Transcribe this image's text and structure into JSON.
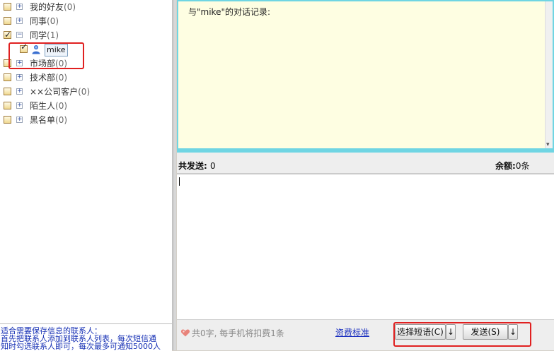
{
  "tree": {
    "groups": [
      {
        "name": "我的好友",
        "count": "(0)",
        "checked": false
      },
      {
        "name": "同事",
        "count": "(0)",
        "checked": false
      },
      {
        "name": "同学",
        "count": "(1)",
        "checked": true
      }
    ],
    "child": {
      "name": "mike"
    },
    "groups_after": [
      {
        "name": "市场部",
        "count": "(0)"
      },
      {
        "name": "技术部",
        "count": "(0)"
      },
      {
        "name": "××公司客户",
        "count": "(0)"
      },
      {
        "name": "陌生人",
        "count": "(0)"
      },
      {
        "name": "黑名单",
        "count": "(0)"
      }
    ]
  },
  "tip": {
    "line1": "适合需要保存信息的联系人：",
    "line2": "首先把联系人添加到联系人列表，每次短信通",
    "line3": "知时勾选联系人即可，每次最多可通知5000人"
  },
  "history": {
    "title": "与\"mike\"的对话记录:"
  },
  "info": {
    "sent_label": "共发送:",
    "sent_value": "0",
    "balance_label": "余额:",
    "balance_value": "0条"
  },
  "bottom": {
    "count_text": "共0字, 每手机将扣费1条",
    "fee_link": "资费标准",
    "phrase_button": "选择短语(C)",
    "phrase_arrow": "↓",
    "send_button": "发送(S)",
    "send_arrow": "↓"
  },
  "colors": {
    "accent_cyan": "#6fd5e3",
    "highlight_red": "#e02020",
    "history_bg": "#fefee2",
    "tip_text": "#1630b5"
  }
}
